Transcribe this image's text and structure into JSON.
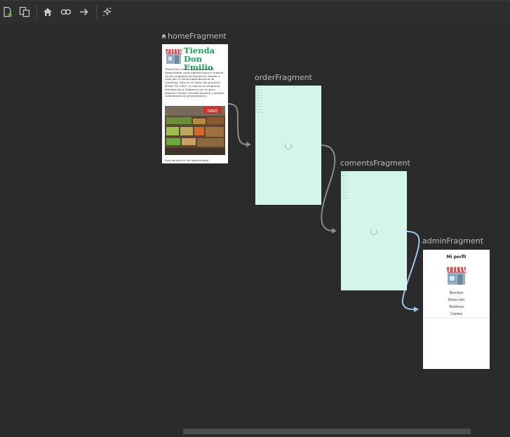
{
  "toolbar": {
    "buttons": [
      {
        "name": "new-destination-icon",
        "label": "New destination"
      },
      {
        "name": "nested-graph-icon",
        "label": "Create nested graph"
      },
      {
        "name": "home-icon",
        "label": "Assign start destination"
      },
      {
        "name": "link-icon",
        "label": "Add deep link"
      },
      {
        "name": "arrow-right-icon",
        "label": "Add action"
      },
      {
        "name": "auto-arrange-icon",
        "label": "Auto arrange"
      }
    ]
  },
  "fragments": {
    "home": {
      "label": "homeFragment",
      "title_line1": "Tienda",
      "title_line2": "Don Emilio",
      "description": "Tienda Don Emilio es una aplicación desarrollada como ejemplo para el módulo 4b del programa de formación llevado a cabo por la Universidad Nacional de Colombia. Este en el marco del proyecto Misión TIC 2022, el cual es un programa liderado por el Gobierno con un gran objetivo: formar 100.000 jóvenes y adultos colombianos en programación.",
      "photo_sign": "SAVE",
      "footer": "Esta aplicación fue desarrollada"
    },
    "order": {
      "label": "orderFragment"
    },
    "coments": {
      "label": "comentsFragment"
    },
    "admin": {
      "label": "adminFragment",
      "title": "Mi perfil",
      "fields": [
        "Nombre",
        "Dirección",
        "Teléfono",
        "Correo"
      ]
    }
  },
  "placeholder_lines": "Item 1\nItem 2\nItem 3\nItem 4\nItem 5\nItem 6\nItem 7\nItem 8\nItem 9\nItem 10",
  "colors": {
    "canvas": "#2b2b2b",
    "placeholder": "#d4f5e9",
    "action_arrow": "#8a8a8a",
    "selected_action_arrow": "#9dc7ef",
    "brand_green": "#1fa35b"
  }
}
